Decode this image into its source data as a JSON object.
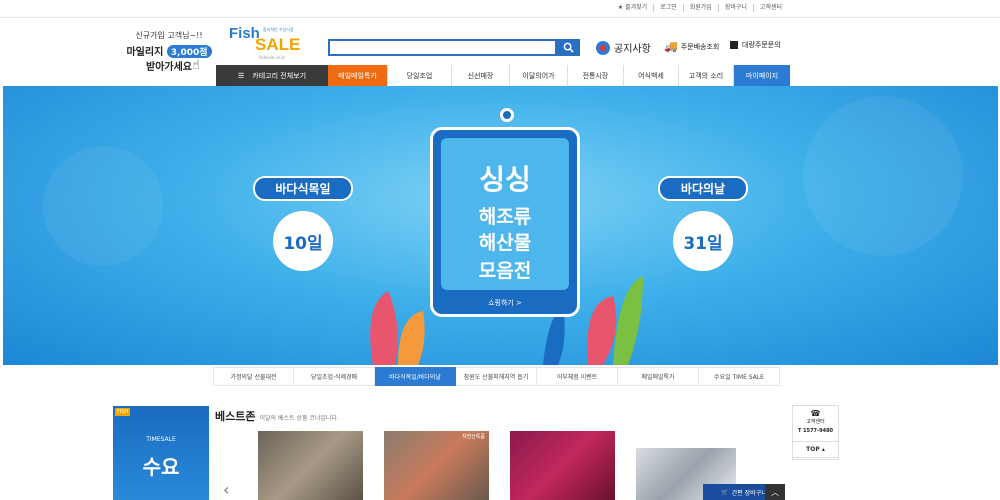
{
  "top_links": [
    "★ 즐겨찾기",
    "로그인",
    "회원가입",
    "장바구니",
    "고객센터"
  ],
  "promo": {
    "line1": "신규가입 고객님~!!",
    "line2_prefix": "마일리지",
    "amount": "3,000점",
    "line3": "받아가세요"
  },
  "logo": {
    "fish": "Fish",
    "sale": "SALE",
    "tagline": "합리적인 수산시장",
    "url": "fishsale.co.kr"
  },
  "search": {
    "placeholder": ""
  },
  "header_links": {
    "notice": "공지사항",
    "delivery": "주문배송조회",
    "bulk": "대량주문문의"
  },
  "nav": {
    "category": "카테고리 전체보기",
    "hot": "매일매일특가",
    "items": [
      "당일조업",
      "신선매장",
      "이달의어가",
      "전통시장",
      "어식백세",
      "고객의 소리"
    ],
    "mypage": "마이페이지"
  },
  "banner": {
    "left_ribbon": "바다식목일",
    "left_day": "10일",
    "right_ribbon": "바다의날",
    "right_day": "31일",
    "title1": "싱싱",
    "title2": "해조류",
    "title3": "해산물",
    "title4": "모음전",
    "shop": "쇼핑하기 >"
  },
  "subnav": [
    "가정의달 선물대전",
    "당일조업·삭제경매",
    "바다식목일/바다의날",
    "참원도 산불피해지역 돕기",
    "어부체험 이벤트",
    "매일매일특가",
    "수요일 TIME SALE"
  ],
  "subnav_active": 2,
  "best": {
    "title": "베스트존",
    "subtitle": "이달의 베스트 상품 코너입니다.",
    "side_box_small": "TIMESALE",
    "side_box_big": "수요",
    "side_box_corner": "FISH"
  },
  "product_tag": "자연산특품",
  "cs": {
    "label": "고객센터",
    "phone": "T 1577-9480",
    "top": "TOP ▴"
  },
  "cart": {
    "label": "간편 장바구니",
    "toggle": "︿"
  },
  "colors": {
    "brand_blue": "#2a7bd1",
    "hot_orange": "#f06a12",
    "nav_dark": "#3a3a3a"
  }
}
